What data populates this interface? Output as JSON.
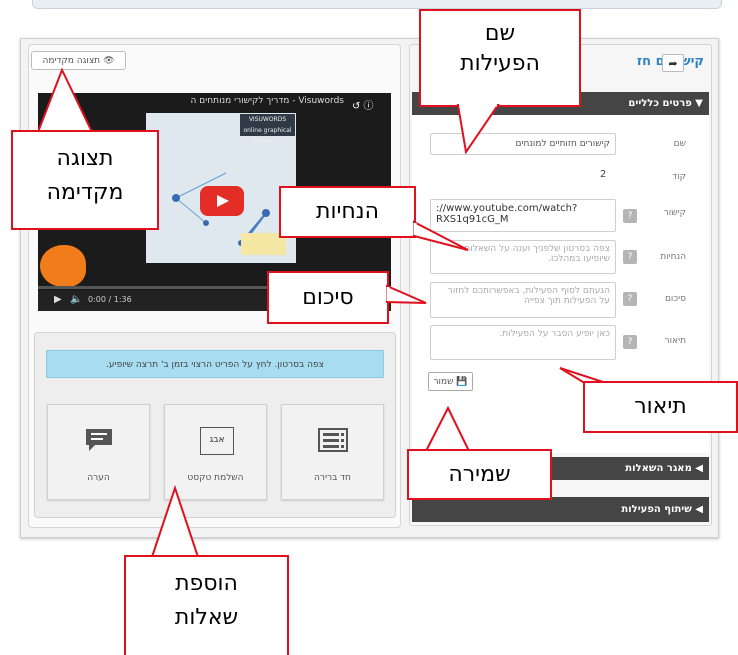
{
  "preview_button": {
    "label": "תצוגה מקדימה"
  },
  "video": {
    "title": "Visuwords - מדריך לקישורי מנותחים ה",
    "banner": "VISUWORDS\nonline graphical dictionary",
    "time": "0:00 / 1:36"
  },
  "instructions_bar": {
    "text": "צפה בסרטון. לחץ על הפריט הרצוי בזמן ב' תרצה שיופיע."
  },
  "question_types": [
    {
      "label": "הערה",
      "icon": "comment-icon"
    },
    {
      "label": "השלמת טקסט",
      "icon": "text-fill-icon"
    },
    {
      "label": "חד ברירה",
      "icon": "list-icon"
    }
  ],
  "question_type_icon_text": "אבג",
  "activity_title": "קישורים חז",
  "sections": {
    "general": "פרטים כלליים",
    "question_bank": "מאגר השאלות",
    "share": "שיתוף הפעילות"
  },
  "form": {
    "name_label": "שם",
    "name_value": "קישורים חזותיים למונחים",
    "code_label": "קוד",
    "code_value": "2",
    "link_label": "קישור",
    "link_value": "://www.youtube.com/watch?\nRXS1q91cG_M",
    "instructions_label": "הנחיות",
    "instructions_placeholder": "צפה בסרטון שלפניך וענה על השאלות שיופיעו במהלכו.",
    "summary_label": "סיכום",
    "summary_placeholder": "הגעתם לסוף הפעילות, באפשרותכם לחזור על הפעילות תוך צפייה",
    "description_label": "תיאור",
    "description_placeholder": "כאן יופיע הסבר על הפעילות.",
    "hint_icon": "?"
  },
  "save_button": {
    "label": "שמור"
  },
  "callouts": {
    "activity_name": "שם\nהפעילות",
    "preview": "תצוגה\nמקדימה",
    "instructions": "הנחיות",
    "summary": "סיכום",
    "description": "תיאור",
    "save": "שמירה",
    "add_questions": "הוספת\nשאלות"
  },
  "colors": {
    "callout_border": "#e0101f",
    "section_header": "#454545",
    "title_blue": "#2b84c6",
    "info_bar": "#a8dcf0",
    "play_red": "#e52d27"
  }
}
